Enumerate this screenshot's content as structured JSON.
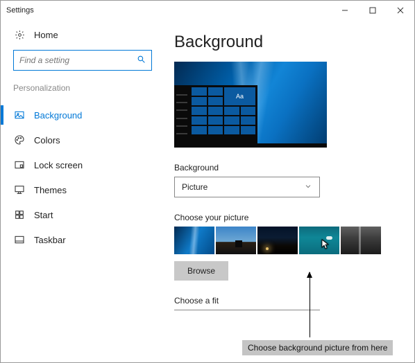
{
  "window": {
    "title": "Settings"
  },
  "sidebar": {
    "home": "Home",
    "search_placeholder": "Find a setting",
    "section": "Personalization",
    "items": [
      {
        "label": "Background",
        "icon": "picture-icon",
        "active": true
      },
      {
        "label": "Colors",
        "icon": "palette-icon",
        "active": false
      },
      {
        "label": "Lock screen",
        "icon": "lockscreen-icon",
        "active": false
      },
      {
        "label": "Themes",
        "icon": "themes-icon",
        "active": false
      },
      {
        "label": "Start",
        "icon": "start-icon",
        "active": false
      },
      {
        "label": "Taskbar",
        "icon": "taskbar-icon",
        "active": false
      }
    ]
  },
  "main": {
    "title": "Background",
    "preview_sample_text": "Aa",
    "bg_label": "Background",
    "bg_value": "Picture",
    "choose_label": "Choose your picture",
    "browse": "Browse",
    "fit_label": "Choose a fit"
  },
  "annotation": {
    "text": "Choose background picture from here"
  }
}
